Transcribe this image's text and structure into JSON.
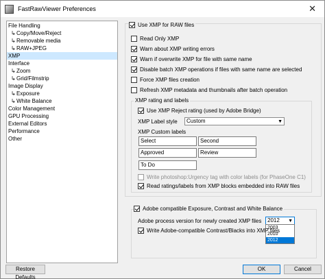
{
  "window": {
    "title": "FastRawViewer Preferences",
    "close_glyph": "✕"
  },
  "sidebar": {
    "items": [
      {
        "label": "File Handling",
        "sub": false,
        "selected": false
      },
      {
        "label": "Copy/Move/Reject",
        "sub": true,
        "selected": false
      },
      {
        "label": "Removable media",
        "sub": true,
        "selected": false
      },
      {
        "label": "RAW+JPEG",
        "sub": true,
        "selected": false
      },
      {
        "label": "XMP",
        "sub": false,
        "selected": true
      },
      {
        "label": "Interface",
        "sub": false,
        "selected": false
      },
      {
        "label": "Zoom",
        "sub": true,
        "selected": false
      },
      {
        "label": "Grid/Filmstrip",
        "sub": true,
        "selected": false
      },
      {
        "label": "Image Display",
        "sub": false,
        "selected": false
      },
      {
        "label": "Exposure",
        "sub": true,
        "selected": false
      },
      {
        "label": "White Balance",
        "sub": true,
        "selected": false
      },
      {
        "label": "Color Management",
        "sub": false,
        "selected": false
      },
      {
        "label": "GPU Processing",
        "sub": false,
        "selected": false
      },
      {
        "label": "External Editors",
        "sub": false,
        "selected": false
      },
      {
        "label": "Performance",
        "sub": false,
        "selected": false
      },
      {
        "label": "Other",
        "sub": false,
        "selected": false
      }
    ]
  },
  "xmp": {
    "use_xmp_label": "Use XMP for RAW files",
    "options": [
      {
        "label": "Read Only XMP",
        "checked": false
      },
      {
        "label": "Warn about XMP writing errors",
        "checked": true
      },
      {
        "label": "Warn if overwrite XMP for file with same name",
        "checked": true
      },
      {
        "label": "Disable batch XMP operations if files with same name are selected",
        "checked": true
      },
      {
        "label": "Force XMP files creation",
        "checked": false
      },
      {
        "label": "Refresh XMP metadata and thumbnails after batch operation",
        "checked": false
      }
    ],
    "rating_group": {
      "title": "XMP rating and labels",
      "reject_label": "Use XMP Reject rating (used by Adobe Bridge)",
      "label_style_label": "XMP Label style",
      "label_style_value": "Custom",
      "custom_labels_title": "XMP Custom labels",
      "custom_labels": [
        "Select",
        "Second",
        "Approved",
        "Review",
        "To Do"
      ],
      "urgency_label": "Write photoshop:Urgency tag with color labels (for PhaseOne C1)",
      "read_ratings_label": "Read ratings/labels from XMP blocks embedded into RAW files"
    },
    "adobe_group": {
      "title": "Adobe compatible Exposure, Contrast and White Balance",
      "process_version_label": "Adobe process version for newly created XMP files",
      "process_version_value": "2012",
      "process_version_options": [
        "2003",
        "2010",
        "2012"
      ],
      "write_contrast_label": "Write Adobe-compatible Contrast/Blacks into XMP files"
    }
  },
  "buttons": {
    "restore": "Restore Defaults",
    "ok": "OK",
    "cancel": "Cancel"
  }
}
